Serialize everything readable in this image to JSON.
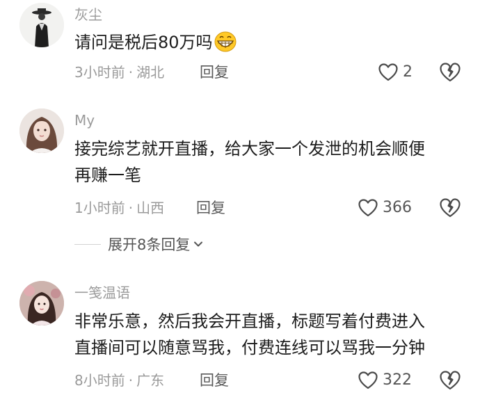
{
  "comments": [
    {
      "username": "灰尘",
      "text": "请问是税后80万吗",
      "emoji": "grinning-emoji",
      "time": "3小时前",
      "location": "湖北",
      "reply_label": "回复",
      "likes": "2"
    },
    {
      "username": "My",
      "text_line1": "接完综艺就开直播，给大家一个发泄的机会顺便",
      "text_line2": "再赚一笔",
      "time": "1小时前",
      "location": "山西",
      "reply_label": "回复",
      "likes": "366"
    },
    {
      "username": "一笺温语",
      "text_line1": "非常乐意，然后我会开直播，标题写着付费进入",
      "text_line2": "直播间可以随意骂我，付费连线可以骂我一分钟",
      "time": "8小时前",
      "location": "广东",
      "reply_label": "回复",
      "likes": "322"
    }
  ],
  "expand_replies": "展开8条回复",
  "separator": "·",
  "icons": {
    "like": "heart-outline-icon",
    "dislike": "broken-heart-icon",
    "expand": "chevron-down-icon"
  },
  "colors": {
    "meta": "#9a9a9a",
    "text": "#1c1c1c"
  }
}
